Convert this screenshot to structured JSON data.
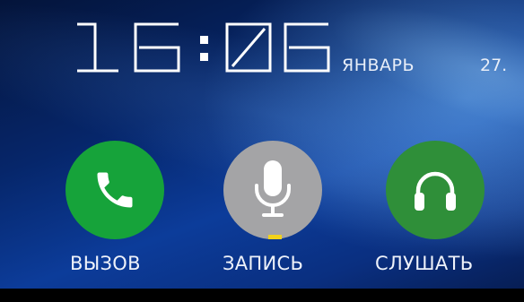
{
  "status": {
    "time": "16:06",
    "hours_digits": [
      "1",
      "6"
    ],
    "minutes_digits": [
      "0",
      "6"
    ],
    "month": "ЯНВАРЬ",
    "day": "27."
  },
  "actions": [
    {
      "id": "call",
      "label": "ВЫЗОВ",
      "icon": "phone-icon",
      "color": "#16a33a"
    },
    {
      "id": "record",
      "label": "ЗАПИСЬ",
      "icon": "microphone-icon",
      "color": "#a4a4a6",
      "selected": true
    },
    {
      "id": "listen",
      "label": "СЛУШАТЬ",
      "icon": "headphones-icon",
      "color": "#2f8f39"
    }
  ],
  "selection_indicator_color": "#f2d21b"
}
